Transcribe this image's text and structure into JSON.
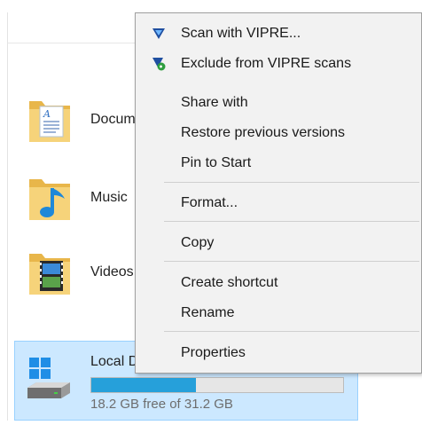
{
  "explorer": {
    "folders": [
      {
        "label": "Docum",
        "icon": "documents-folder-icon"
      },
      {
        "label": "Music",
        "icon": "music-folder-icon"
      },
      {
        "label": "Videos",
        "icon": "videos-folder-icon"
      }
    ],
    "drive": {
      "label": "Local D",
      "free_text": "18.2 GB free of 31.2 GB",
      "used_fraction": 0.417,
      "bar_color": "#26a0da",
      "icon": "windows-drive-icon"
    }
  },
  "context_menu": {
    "items": [
      {
        "label": "Scan with VIPRE...",
        "icon": "vipre-scan-icon"
      },
      {
        "label": "Exclude from VIPRE scans",
        "icon": "vipre-exclude-icon"
      },
      {
        "label": "Share with"
      },
      {
        "label": "Restore previous versions"
      },
      {
        "label": "Pin to Start"
      },
      {
        "label": "Format..."
      },
      {
        "label": "Copy"
      },
      {
        "label": "Create shortcut"
      },
      {
        "label": "Rename"
      },
      {
        "label": "Properties"
      }
    ]
  },
  "colors": {
    "menu_background": "#f2f2f2",
    "selection_background": "#cce8ff",
    "selection_border": "#99d1ff",
    "vipre_blue": "#1f4fa0",
    "vipre_green": "#2e9e3f"
  }
}
